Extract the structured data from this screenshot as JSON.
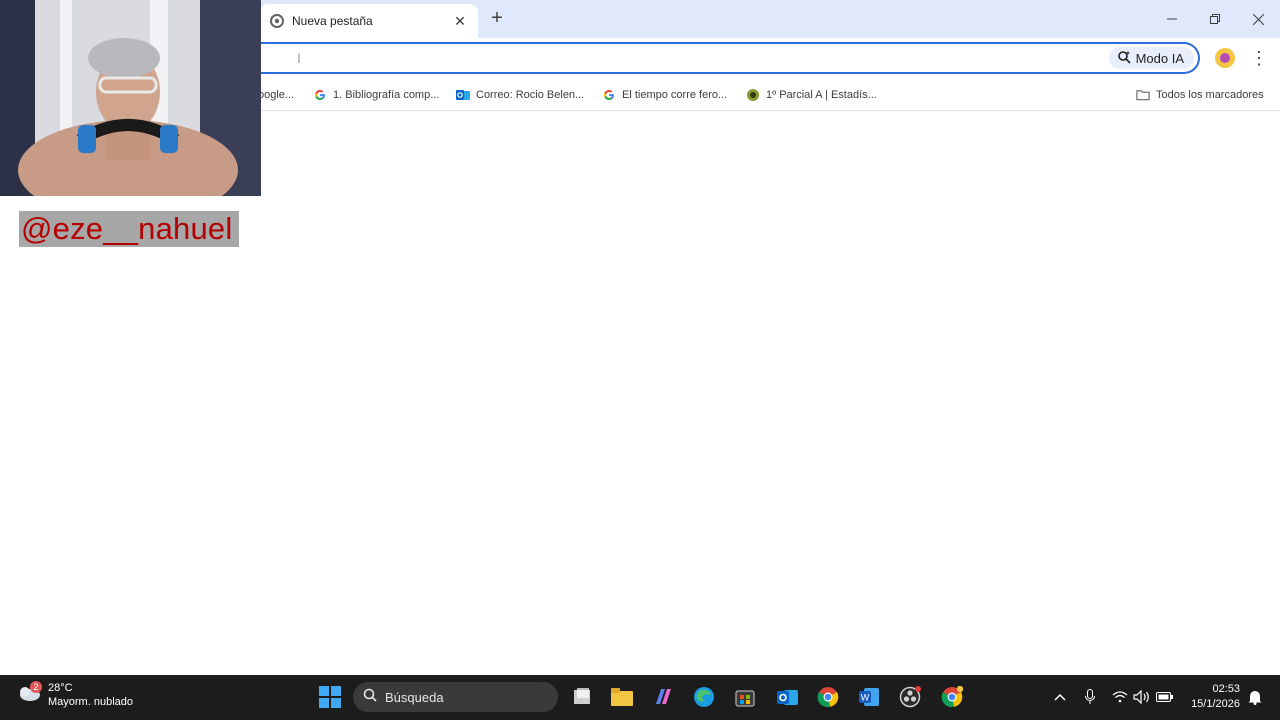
{
  "tab": {
    "title": "Nueva pestaña"
  },
  "omnibox": {
    "ai_mode_label": "Modo IA"
  },
  "bookmarks": {
    "items": [
      {
        "label": "oogle..."
      },
      {
        "label": "1. Bibliografía comp..."
      },
      {
        "label": "Correo: Rocio Belen..."
      },
      {
        "label": "El tiempo corre fero..."
      },
      {
        "label": "1º Parcial A | Estadís..."
      }
    ],
    "all_label": "Todos los marcadores"
  },
  "overlay": {
    "handle": "@eze__nahuel"
  },
  "taskbar": {
    "weather": {
      "temp": "28°C",
      "desc": "Mayorm. nublado",
      "badge": "2"
    },
    "search_label": "Búsqueda",
    "clock": {
      "time": "02:53",
      "date": "15/1/2026"
    }
  },
  "colors": {
    "accent": "#2b6de0",
    "handle_text": "#b40000",
    "taskbar": "#1c1c1c"
  }
}
